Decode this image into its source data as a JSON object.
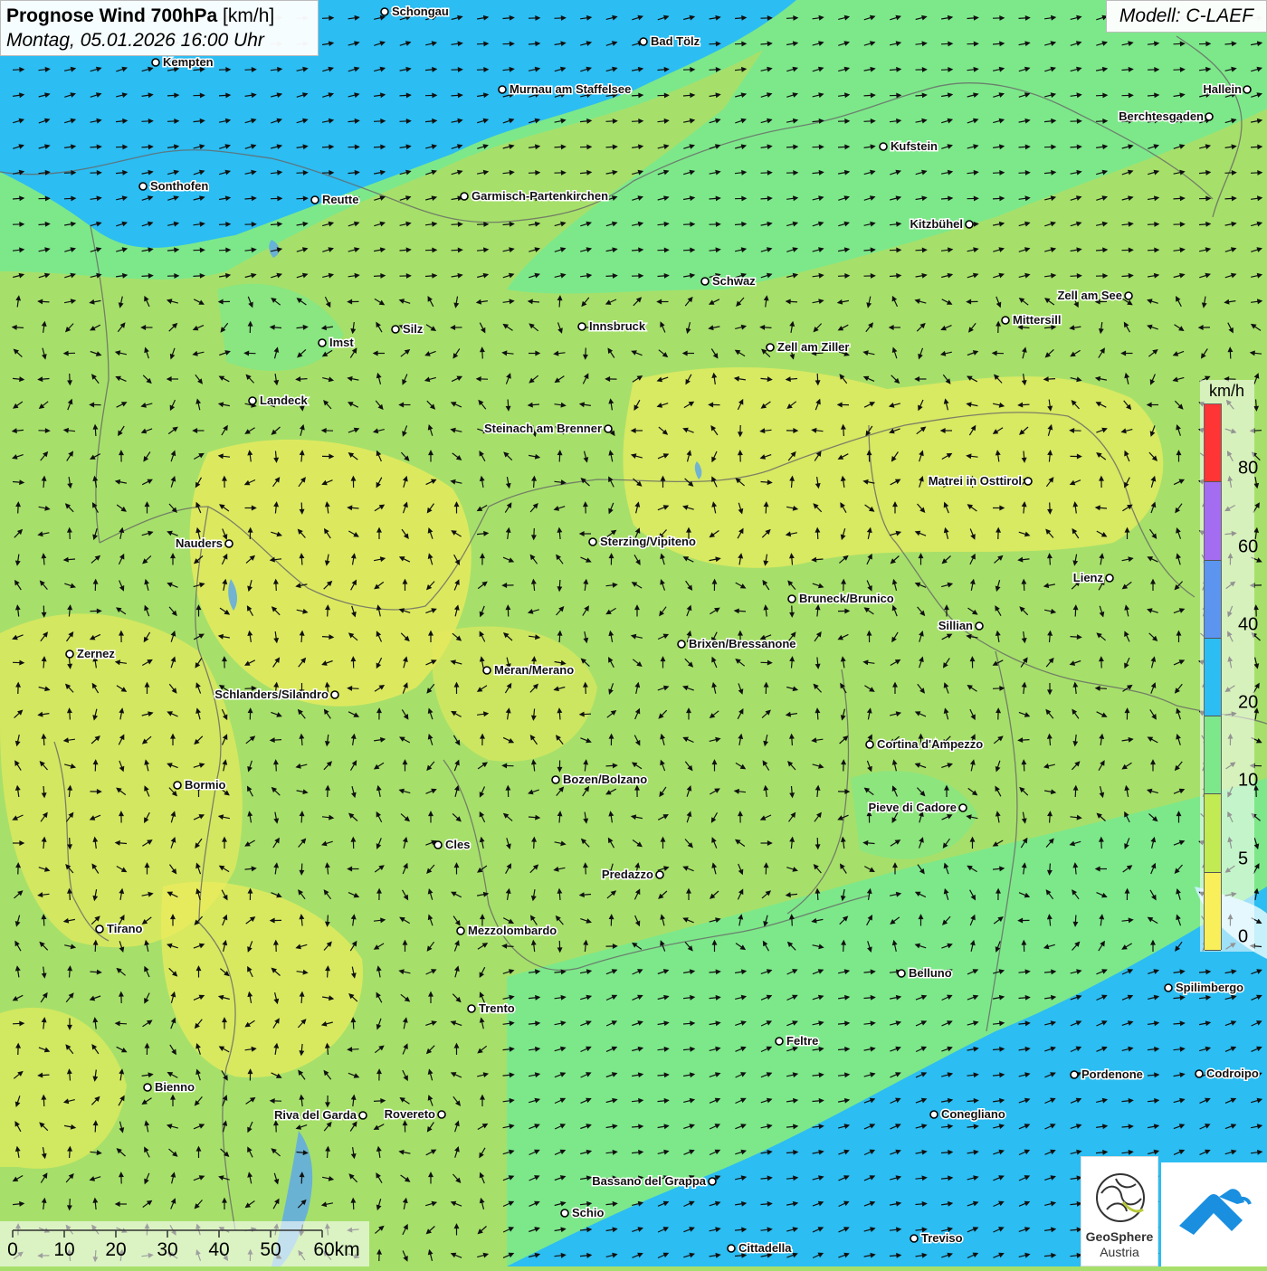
{
  "title": {
    "main": "Prognose Wind 700hPa",
    "unit": "[km/h]",
    "datetime": "Montag, 05.01.2026 16:00 Uhr"
  },
  "model": "Modell: C-LAEF",
  "legend": {
    "unit": "km/h",
    "ticks": [
      "80",
      "60",
      "40",
      "20",
      "10",
      "5",
      "0"
    ],
    "colors": [
      "#ff3434",
      "#a46cf0",
      "#5b95f0",
      "#2cbdf2",
      "#7de88a",
      "#c2ea52",
      "#f8ef5a"
    ]
  },
  "scale_bar": {
    "labels": [
      "0",
      "10",
      "20",
      "30",
      "40",
      "50",
      "60km"
    ]
  },
  "logo": {
    "name_line1": "GeoSphere",
    "name_line2": "Austria"
  },
  "cities": [
    {
      "name": "Schongau",
      "id": "schongau"
    },
    {
      "name": "Bad Tölz",
      "id": "bad-toelz"
    },
    {
      "name": "Kempten",
      "id": "kempten"
    },
    {
      "name": "Murnau am Staffelsee",
      "id": "murnau"
    },
    {
      "name": "Hallein",
      "id": "hallein"
    },
    {
      "name": "Berchtesgaden",
      "id": "berchtesgaden"
    },
    {
      "name": "Kufstein",
      "id": "kufstein"
    },
    {
      "name": "Sonthofen",
      "id": "sonthofen"
    },
    {
      "name": "Reutte",
      "id": "reutte"
    },
    {
      "name": "Garmisch-Partenkirchen",
      "id": "garmisch"
    },
    {
      "name": "Kitzbühel",
      "id": "kitzbuehel"
    },
    {
      "name": "Schwaz",
      "id": "schwaz"
    },
    {
      "name": "Zell am See",
      "id": "zell-am-see"
    },
    {
      "name": "Mittersill",
      "id": "mittersill"
    },
    {
      "name": "Innsbruck",
      "id": "innsbruck"
    },
    {
      "name": "Silz",
      "id": "silz"
    },
    {
      "name": "Imst",
      "id": "imst"
    },
    {
      "name": "Zell am Ziller",
      "id": "zell-am-ziller"
    },
    {
      "name": "Landeck",
      "id": "landeck"
    },
    {
      "name": "Steinach am Brenner",
      "id": "steinach"
    },
    {
      "name": "Matrei in Osttirol",
      "id": "matrei"
    },
    {
      "name": "Nauders",
      "id": "nauders"
    },
    {
      "name": "Sterzing/Vipiteno",
      "id": "sterzing"
    },
    {
      "name": "Lienz",
      "id": "lienz"
    },
    {
      "name": "Bruneck/Brunico",
      "id": "bruneck"
    },
    {
      "name": "Sillian",
      "id": "sillian"
    },
    {
      "name": "Zernez",
      "id": "zernez"
    },
    {
      "name": "Brixen/Bressanone",
      "id": "brixen"
    },
    {
      "name": "Meran/Merano",
      "id": "meran"
    },
    {
      "name": "Schlanders/Silandro",
      "id": "schlanders"
    },
    {
      "name": "Cortina d'Ampezzo",
      "id": "cortina"
    },
    {
      "name": "Bormio",
      "id": "bormio"
    },
    {
      "name": "Bozen/Bolzano",
      "id": "bozen"
    },
    {
      "name": "Pieve di Cadore",
      "id": "pieve"
    },
    {
      "name": "Cles",
      "id": "cles"
    },
    {
      "name": "Predazzo",
      "id": "predazzo"
    },
    {
      "name": "Tirano",
      "id": "tirano"
    },
    {
      "name": "Mezzolombardo",
      "id": "mezzolombardo"
    },
    {
      "name": "Belluno",
      "id": "belluno"
    },
    {
      "name": "Spilimbergo",
      "id": "spilimbergo"
    },
    {
      "name": "Trento",
      "id": "trento"
    },
    {
      "name": "Feltre",
      "id": "feltre"
    },
    {
      "name": "Pordenone",
      "id": "pordenone"
    },
    {
      "name": "Codroipo",
      "id": "codroipo"
    },
    {
      "name": "Bienno",
      "id": "bienno"
    },
    {
      "name": "Riva del Garda",
      "id": "riva"
    },
    {
      "name": "Rovereto",
      "id": "rovereto"
    },
    {
      "name": "Conegliano",
      "id": "conegliano"
    },
    {
      "name": "Bassano del Grappa",
      "id": "bassano"
    },
    {
      "name": "Schio",
      "id": "schio"
    },
    {
      "name": "Treviso",
      "id": "treviso"
    },
    {
      "name": "Cittadella",
      "id": "cittadella"
    }
  ]
}
